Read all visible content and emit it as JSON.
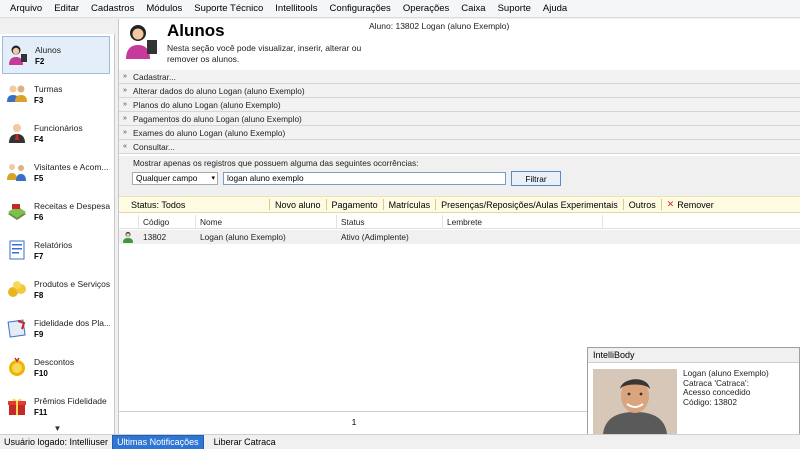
{
  "menu": [
    "Arquivo",
    "Editar",
    "Cadastros",
    "Módulos",
    "Suporte Técnico",
    "Intellitools",
    "Configurações",
    "Operações",
    "Caixa",
    "Suporte",
    "Ajuda"
  ],
  "sidebar": {
    "items": [
      {
        "label": "Alunos",
        "key": "F2",
        "icon": "student-icon",
        "active": true
      },
      {
        "label": "Turmas",
        "key": "F3",
        "icon": "group-icon",
        "active": false
      },
      {
        "label": "Funcionários",
        "key": "F4",
        "icon": "employee-icon",
        "active": false
      },
      {
        "label": "Visitantes e Acom...",
        "key": "F5",
        "icon": "visitors-icon",
        "active": false
      },
      {
        "label": "Receitas e Despesas",
        "key": "F6",
        "icon": "finance-icon",
        "active": false
      },
      {
        "label": "Relatórios",
        "key": "F7",
        "icon": "report-icon",
        "active": false
      },
      {
        "label": "Produtos e Serviços",
        "key": "F8",
        "icon": "products-icon",
        "active": false
      },
      {
        "label": "Fidelidade dos Pla...",
        "key": "F9",
        "icon": "loyalty-icon",
        "active": false
      },
      {
        "label": "Descontos",
        "key": "F10",
        "icon": "discount-icon",
        "active": false
      },
      {
        "label": "Prêmios Fidelidade",
        "key": "F11",
        "icon": "gift-icon",
        "active": false
      }
    ]
  },
  "header": {
    "title": "Alunos",
    "description": "Nesta seção você pode visualizar, inserir, alterar ou remover os alunos.",
    "student_info": "Aluno: 13802  Logan (aluno Exemplo)"
  },
  "sections": [
    {
      "label": "Cadastrar...",
      "expanded": false
    },
    {
      "label": "Alterar dados do aluno Logan (aluno Exemplo)",
      "expanded": false
    },
    {
      "label": "Planos do aluno Logan (aluno Exemplo)",
      "expanded": false
    },
    {
      "label": "Pagamentos do aluno Logan (aluno Exemplo)",
      "expanded": false
    },
    {
      "label": "Exames do aluno Logan (aluno Exemplo)",
      "expanded": false
    },
    {
      "label": "Consultar...",
      "expanded": true
    }
  ],
  "filter": {
    "label": "Mostrar apenas os registros que possuem alguma das seguintes ocorrências:",
    "field_select": "Qualquer campo",
    "query": "logan aluno exemplo",
    "button": "Filtrar"
  },
  "toolbar": {
    "status": "Status: Todos",
    "actions": [
      "Novo aluno",
      "Pagamento",
      "Matrículas",
      "Presenças/Reposições/Aulas Experimentais",
      "Outros"
    ],
    "remove": "Remover"
  },
  "table": {
    "columns": [
      "Código",
      "Nome",
      "Status",
      "Lembrete"
    ],
    "rows": [
      {
        "codigo": "13802",
        "nome": "Logan (aluno Exemplo)",
        "status": "Ativo (Adimplente)",
        "lembrete": ""
      }
    ]
  },
  "pager": {
    "page": "1"
  },
  "popup": {
    "title": "IntelliBody",
    "name": "Logan (aluno Exemplo)",
    "turnstile": "Catraca 'Catraca':",
    "access": "Acesso concedido",
    "code": "Código: 13802"
  },
  "statusbar": {
    "user": "Usuário logado: Intelliuser",
    "notifications": "Ultimas Notificações",
    "release": "Liberar Catraca"
  },
  "colors": {
    "accent": "#2e75d4",
    "toolbar_bg": "#fffbe2",
    "active_nav": "#e4eef8"
  }
}
